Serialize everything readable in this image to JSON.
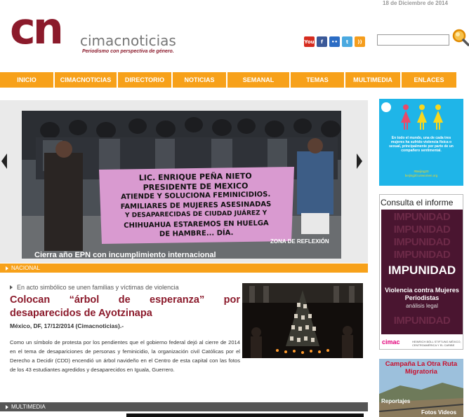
{
  "header": {
    "date": "18 de Diciembre de 2014",
    "logo_mark": "cn",
    "logo_name": "cimacnoticias",
    "logo_tagline": "Periodismo con perspectiva de género."
  },
  "social": [
    {
      "name": "youtube-icon",
      "glyph": "You",
      "color": "#d62c1f"
    },
    {
      "name": "facebook-icon",
      "glyph": "f",
      "color": "#3b5998"
    },
    {
      "name": "flickr-icon",
      "glyph": "••",
      "color": "#2b6cc4"
    },
    {
      "name": "twitter-icon",
      "glyph": "t",
      "color": "#4aa9e0"
    },
    {
      "name": "rss-icon",
      "glyph": "))",
      "color": "#f59d1c"
    }
  ],
  "search": {
    "placeholder": ""
  },
  "nav": {
    "items": [
      "INICIO",
      "CIMACNOTICIAS",
      "DIRECTORIO",
      "NOTICIAS",
      "SEMANAL",
      "TEMAS",
      "MULTIMEDIA",
      "ENLACES"
    ]
  },
  "slider": {
    "section": "ZONA DE REFLEXIÓN",
    "caption": "Cierra año EPN con incumplimiento internacional",
    "banner_lines": [
      "LIC. ENRIQUE PEÑA NIETO",
      "PRESIDENTE DE MEXICO",
      "ATIENDE Y SOLUCIONA FEMINICIDIOS.",
      "FAMILIARES DE MUJERES ASESINADAS",
      "Y DESAPARECIDAS DE CIUDAD JUÁREZ Y",
      "CHIHUAHUA ESTAREMOS EN HUELGA",
      "DE HAMBRE...  DÍA."
    ]
  },
  "sections": {
    "nacional": "NACIONAL",
    "multimedia": "MULTIMEDIA"
  },
  "article": {
    "kicker": "En acto simbólico se unen familias y víctimas de violencia",
    "headline": "Colocan “árbol de esperanza” por desaparecidos de Ayotzinapa",
    "dateline": "México, DF, 17/12/2014 (Cimacnoticias).-",
    "body": "Como un símbolo de protesta por los pendientes que el gobierno federal dejó al cierre de 2014 en el tema de desapariciones de personas y feminicidio, la organización civil Católicas por el Derecho a Decidir (CDD) encendió un árbol navideño en el Centro de esta capital con las fotos de los 43 estudiantes agredidos y desaparecidos en Iguala, Guerrero."
  },
  "sidebar": {
    "ad1": {
      "text": "En todo el mundo, una de cada tres mujeres ha sufrido violencia física o sexual, principalmente por parte de un compañero sentimental.",
      "tags": "#Beijing20\nbeijing20.unwomen.org"
    },
    "ad2": {
      "header": "Consulta el informe",
      "impunidad_repeat": "IMPUNIDAD",
      "main": "IMPUNIDAD",
      "subtitle": "Violencia contra Mujeres Periodistas",
      "small": "análisis legal",
      "cimac": "cimac",
      "partner": "HEINRICH BÖLL STIFTUNG MÉXICO, CENTROAMÉRICA Y EL CARIBE"
    },
    "ad3": {
      "title": "Campaña La Otra Ruta Migratoria",
      "reportajes": "Reportajes",
      "fotos_videos": "Fotos Videos"
    }
  }
}
